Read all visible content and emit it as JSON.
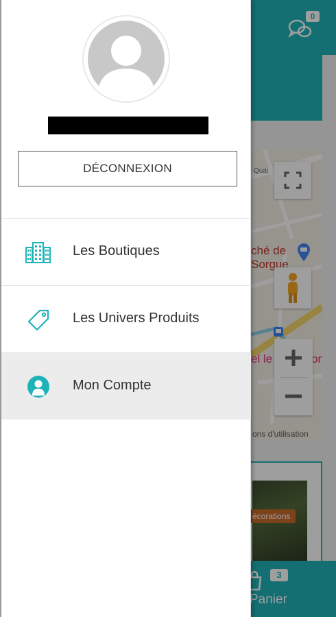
{
  "drawer": {
    "username": "██████████████",
    "logout_label": "DÉCONNEXION",
    "menu": [
      {
        "label": "Les Boutiques",
        "icon": "buildings-icon"
      },
      {
        "label": "Les Univers Produits",
        "icon": "tag-icon"
      },
      {
        "label": "Mon Compte",
        "icon": "user-circle-icon",
        "active": true
      }
    ]
  },
  "background_app": {
    "chat_badge": "0",
    "map": {
      "label_street": "Quai",
      "label_market_line1": "ché de",
      "label_market_line2": "Sorgue",
      "label_pink": "el le",
      "label_pink2": "on",
      "terms": "ons d'utilisation"
    },
    "shop_tag": "écorations",
    "cart_count": "3",
    "cart_label": "Panier"
  },
  "colors": {
    "accent": "#1fb3b8",
    "overlay": "rgba(0,0,0,0.38)",
    "active_item_bg": "#ececec"
  }
}
